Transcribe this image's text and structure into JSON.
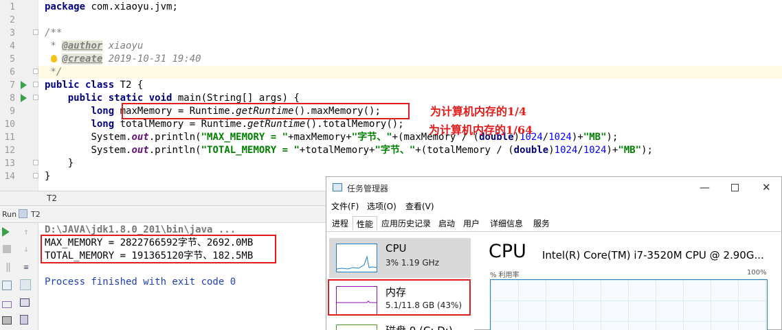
{
  "editor": {
    "line_numbers": [
      "1",
      "2",
      "3",
      "4",
      "5",
      "6",
      "7",
      "8",
      "9",
      "10",
      "11",
      "12",
      "13",
      "14"
    ],
    "code": {
      "l1_kw": "package",
      "l1_rest": " com.xiaoyu.jvm;",
      "l3": "/**",
      "l4_star": " * ",
      "l4_tag": "@author",
      "l4_val": " xiaoyu",
      "l5_tag": "@create",
      "l5_val": " 2019-10-31 19:40",
      "l6": " */",
      "l7_kw": "public class",
      "l7_rest": " T2 {",
      "l8_kw": "public static void",
      "l8_rest": " main(String[] args) {",
      "l9_kw": "long",
      "l9_a": " maxMemory = Runtime.",
      "l9_b": "getRuntime",
      "l9_c": "().maxMemory();",
      "l10_kw": "long",
      "l10_a": " totalMemory = Runtime.",
      "l10_b": "getRuntime",
      "l10_c": "().totalMemory();",
      "l11_a": "System.",
      "l11_out": "out",
      "l11_b": ".println(",
      "l11_s1": "\"MAX_MEMORY = \"",
      "l11_c": "+maxMemory+",
      "l11_s2": "\"字节、\"",
      "l11_d": "+(maxMemory / (",
      "l11_kw": "double",
      "l11_e": ")",
      "l11_n1": "1024",
      "l11_f": "/",
      "l11_n2": "1024",
      "l11_g": ")+",
      "l11_s3": "\"MB\"",
      "l11_h": ");",
      "l12_a": "System.",
      "l12_out": "out",
      "l12_b": ".println(",
      "l12_s1": "\"TOTAL_MEMORY = \"",
      "l12_c": "+totalMemory+",
      "l12_s2": "\"字节、\"",
      "l12_d": "+(totalMemory / (",
      "l12_kw": "double",
      "l12_e": ")",
      "l12_n1": "1024",
      "l12_f": "/",
      "l12_n2": "1024",
      "l12_g": ")+",
      "l12_s3": "\"MB\"",
      "l12_h": ");",
      "l13": "    }",
      "l14": "}"
    },
    "annotation_1": "为计算机内存的1/4",
    "annotation_2": "为计算机内存的1/64",
    "file_tab": "T2"
  },
  "run": {
    "label": "Run",
    "tab_icon": "run-config-icon",
    "tab_name": "T2",
    "command": "D:\\JAVA\\jdk1.8.0_201\\bin\\java ...",
    "output_1": "MAX_MEMORY = 2822766592字节、2692.0MB",
    "output_2": "TOTAL_MEMORY = 191365120字节、182.5MB",
    "finish": "Process finished with exit code 0"
  },
  "task_manager": {
    "title": "任务管理器",
    "menu": [
      "文件(F)",
      "选项(O)",
      "查看(V)"
    ],
    "tabs": [
      "进程",
      "性能",
      "应用历史记录",
      "启动",
      "用户",
      "详细信息",
      "服务"
    ],
    "active_tab": "性能",
    "tiles": [
      {
        "name": "CPU",
        "detail": "3% 1.19 GHz"
      },
      {
        "name": "内存",
        "detail": "5.1/11.8 GB (43%)"
      },
      {
        "name": "磁盘 0 (C: D:)",
        "detail": ""
      }
    ],
    "panel_title": "CPU",
    "cpu_model": "Intel(R) Core(TM) i7-3520M CPU @ 2.90G...",
    "graph_label": "% 利用率",
    "graph_max": "100%",
    "cpu_percent": 3,
    "memory_percent": 43,
    "colors": {
      "cpu": "#1f7fc8",
      "memory": "#8b12ae",
      "selected": "#cde8ff"
    }
  }
}
